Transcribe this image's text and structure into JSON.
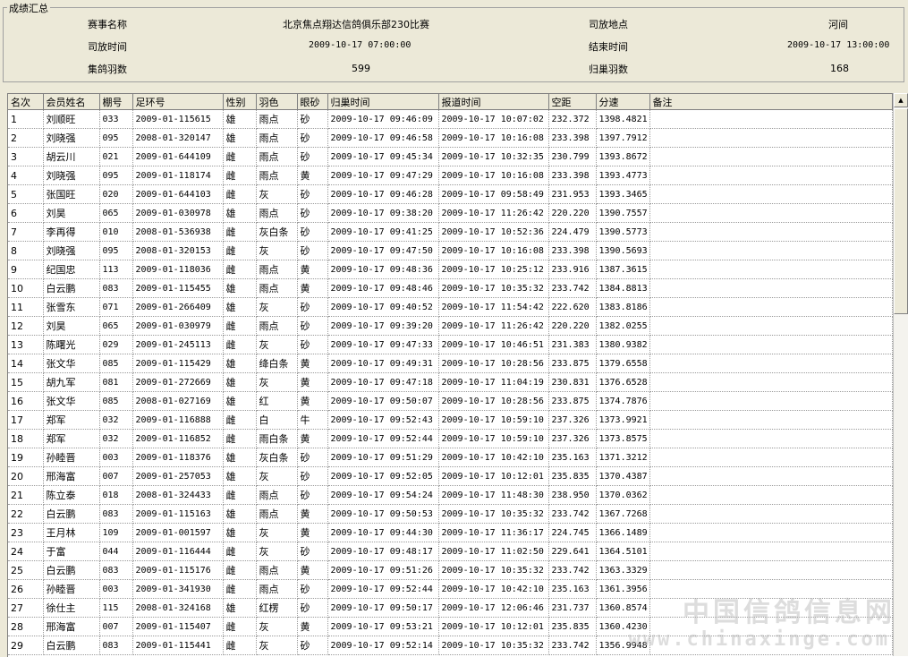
{
  "summary": {
    "legend": "成绩汇总",
    "race_name_label": "赛事名称",
    "race_name": "北京焦点翔达信鸽俱乐部230比赛",
    "release_place_label": "司放地点",
    "release_place": "河间",
    "release_time_label": "司放时间",
    "release_time": "2009-10-17 07:00:00",
    "end_time_label": "结束时间",
    "end_time": "2009-10-17 13:00:00",
    "total_birds_label": "集鸽羽数",
    "total_birds": "599",
    "returned_birds_label": "归巢羽数",
    "returned_birds": "168"
  },
  "table": {
    "columns": [
      "名次",
      "会员姓名",
      "棚号",
      "足环号",
      "性别",
      "羽色",
      "眼砂",
      "归巢时间",
      "报道时间",
      "空距",
      "分速",
      "备注"
    ],
    "rows": [
      [
        "1",
        "刘顺旺",
        "033",
        "2009-01-115615",
        "雄",
        "雨点",
        "砂",
        "2009-10-17 09:46:09",
        "2009-10-17 10:07:02",
        "232.372",
        "1398.4821",
        ""
      ],
      [
        "2",
        "刘晓强",
        "095",
        "2008-01-320147",
        "雄",
        "雨点",
        "砂",
        "2009-10-17 09:46:58",
        "2009-10-17 10:16:08",
        "233.398",
        "1397.7912",
        ""
      ],
      [
        "3",
        "胡云川",
        "021",
        "2009-01-644109",
        "雌",
        "雨点",
        "砂",
        "2009-10-17 09:45:34",
        "2009-10-17 10:32:35",
        "230.799",
        "1393.8672",
        ""
      ],
      [
        "4",
        "刘晓强",
        "095",
        "2009-01-118174",
        "雌",
        "雨点",
        "黄",
        "2009-10-17 09:47:29",
        "2009-10-17 10:16:08",
        "233.398",
        "1393.4773",
        ""
      ],
      [
        "5",
        "张国旺",
        "020",
        "2009-01-644103",
        "雌",
        "灰",
        "砂",
        "2009-10-17 09:46:28",
        "2009-10-17 09:58:49",
        "231.953",
        "1393.3465",
        ""
      ],
      [
        "6",
        "刘昊",
        "065",
        "2009-01-030978",
        "雄",
        "雨点",
        "砂",
        "2009-10-17 09:38:20",
        "2009-10-17 11:26:42",
        "220.220",
        "1390.7557",
        ""
      ],
      [
        "7",
        "李再得",
        "010",
        "2008-01-536938",
        "雌",
        "灰白条",
        "砂",
        "2009-10-17 09:41:25",
        "2009-10-17 10:52:36",
        "224.479",
        "1390.5773",
        ""
      ],
      [
        "8",
        "刘晓强",
        "095",
        "2008-01-320153",
        "雌",
        "灰",
        "砂",
        "2009-10-17 09:47:50",
        "2009-10-17 10:16:08",
        "233.398",
        "1390.5693",
        ""
      ],
      [
        "9",
        "纪国忠",
        "113",
        "2009-01-118036",
        "雌",
        "雨点",
        "黄",
        "2009-10-17 09:48:36",
        "2009-10-17 10:25:12",
        "233.916",
        "1387.3615",
        ""
      ],
      [
        "10",
        "白云鹏",
        "083",
        "2009-01-115455",
        "雄",
        "雨点",
        "黄",
        "2009-10-17 09:48:46",
        "2009-10-17 10:35:32",
        "233.742",
        "1384.8813",
        ""
      ],
      [
        "11",
        "张雪东",
        "071",
        "2009-01-266409",
        "雄",
        "灰",
        "砂",
        "2009-10-17 09:40:52",
        "2009-10-17 11:54:42",
        "222.620",
        "1383.8186",
        ""
      ],
      [
        "12",
        "刘昊",
        "065",
        "2009-01-030979",
        "雌",
        "雨点",
        "砂",
        "2009-10-17 09:39:20",
        "2009-10-17 11:26:42",
        "220.220",
        "1382.0255",
        ""
      ],
      [
        "13",
        "陈曙光",
        "029",
        "2009-01-245113",
        "雌",
        "灰",
        "砂",
        "2009-10-17 09:47:33",
        "2009-10-17 10:46:51",
        "231.383",
        "1380.9382",
        ""
      ],
      [
        "14",
        "张文华",
        "085",
        "2009-01-115429",
        "雄",
        "绛白条",
        "黄",
        "2009-10-17 09:49:31",
        "2009-10-17 10:28:56",
        "233.875",
        "1379.6558",
        ""
      ],
      [
        "15",
        "胡九军",
        "081",
        "2009-01-272669",
        "雄",
        "灰",
        "黄",
        "2009-10-17 09:47:18",
        "2009-10-17 11:04:19",
        "230.831",
        "1376.6528",
        ""
      ],
      [
        "16",
        "张文华",
        "085",
        "2008-01-027169",
        "雄",
        "红",
        "黄",
        "2009-10-17 09:50:07",
        "2009-10-17 10:28:56",
        "233.875",
        "1374.7876",
        ""
      ],
      [
        "17",
        "郑军",
        "032",
        "2009-01-116888",
        "雌",
        "白",
        "牛",
        "2009-10-17 09:52:43",
        "2009-10-17 10:59:10",
        "237.326",
        "1373.9921",
        ""
      ],
      [
        "18",
        "郑军",
        "032",
        "2009-01-116852",
        "雌",
        "雨白条",
        "黄",
        "2009-10-17 09:52:44",
        "2009-10-17 10:59:10",
        "237.326",
        "1373.8575",
        ""
      ],
      [
        "19",
        "孙睦晋",
        "003",
        "2009-01-118376",
        "雄",
        "灰白条",
        "砂",
        "2009-10-17 09:51:29",
        "2009-10-17 10:42:10",
        "235.163",
        "1371.3212",
        ""
      ],
      [
        "20",
        "邢海富",
        "007",
        "2009-01-257053",
        "雄",
        "灰",
        "砂",
        "2009-10-17 09:52:05",
        "2009-10-17 10:12:01",
        "235.835",
        "1370.4387",
        ""
      ],
      [
        "21",
        "陈立泰",
        "018",
        "2008-01-324433",
        "雌",
        "雨点",
        "砂",
        "2009-10-17 09:54:24",
        "2009-10-17 11:48:30",
        "238.950",
        "1370.0362",
        ""
      ],
      [
        "22",
        "白云鹏",
        "083",
        "2009-01-115163",
        "雄",
        "雨点",
        "黄",
        "2009-10-17 09:50:53",
        "2009-10-17 10:35:32",
        "233.742",
        "1367.7268",
        ""
      ],
      [
        "23",
        "王月林",
        "109",
        "2009-01-001597",
        "雄",
        "灰",
        "黄",
        "2009-10-17 09:44:30",
        "2009-10-17 11:36:17",
        "224.745",
        "1366.1489",
        ""
      ],
      [
        "24",
        "于富",
        "044",
        "2009-01-116444",
        "雌",
        "灰",
        "砂",
        "2009-10-17 09:48:17",
        "2009-10-17 11:02:50",
        "229.641",
        "1364.5101",
        ""
      ],
      [
        "25",
        "白云鹏",
        "083",
        "2009-01-115176",
        "雌",
        "雨点",
        "黄",
        "2009-10-17 09:51:26",
        "2009-10-17 10:35:32",
        "233.742",
        "1363.3329",
        ""
      ],
      [
        "26",
        "孙睦晋",
        "003",
        "2009-01-341930",
        "雌",
        "雨点",
        "砂",
        "2009-10-17 09:52:44",
        "2009-10-17 10:42:10",
        "235.163",
        "1361.3956",
        ""
      ],
      [
        "27",
        "徐仕主",
        "115",
        "2008-01-324168",
        "雄",
        "红楞",
        "砂",
        "2009-10-17 09:50:17",
        "2009-10-17 12:06:46",
        "231.737",
        "1360.8574",
        ""
      ],
      [
        "28",
        "邢海富",
        "007",
        "2009-01-115407",
        "雌",
        "灰",
        "黄",
        "2009-10-17 09:53:21",
        "2009-10-17 10:12:01",
        "235.835",
        "1360.4230",
        ""
      ],
      [
        "29",
        "白云鹏",
        "083",
        "2009-01-115441",
        "雌",
        "灰",
        "砂",
        "2009-10-17 09:52:14",
        "2009-10-17 10:35:32",
        "233.742",
        "1356.9948",
        ""
      ]
    ]
  },
  "scrollbar": {
    "up_arrow": "▲"
  },
  "watermark": {
    "cn": "中国信鸽信息网",
    "url": "www.chinaxinge.com"
  }
}
